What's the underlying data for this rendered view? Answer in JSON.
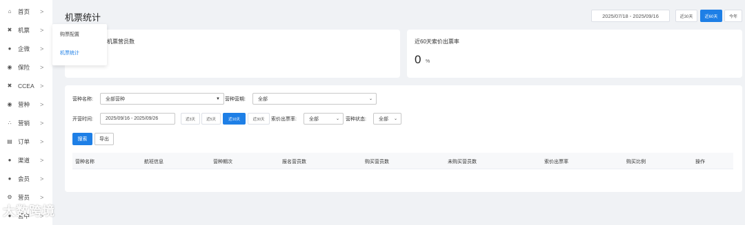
{
  "sidebar": {
    "items": [
      {
        "label": "首页",
        "icon": "home-icon"
      },
      {
        "label": "机票",
        "icon": "tools-icon"
      },
      {
        "label": "企微",
        "icon": "chat-icon"
      },
      {
        "label": "保险",
        "icon": "shield-icon"
      },
      {
        "label": "CCEA",
        "icon": "tools-icon"
      },
      {
        "label": "营种",
        "icon": "badge-icon"
      },
      {
        "label": "营销",
        "icon": "network-icon"
      },
      {
        "label": "订单",
        "icon": "list-icon"
      },
      {
        "label": "渠道",
        "icon": "handshake-icon"
      },
      {
        "label": "会员",
        "icon": "user-icon"
      },
      {
        "label": "营员",
        "icon": "gear-icon"
      },
      {
        "label": "营中",
        "icon": "user-icon"
      }
    ]
  },
  "submenu": {
    "items": [
      {
        "label": "购票配置"
      },
      {
        "label": "机票统计"
      }
    ]
  },
  "header": {
    "title": "机票统计",
    "date_range": "2025/07/18 - 2025/09/16",
    "quick_buttons": [
      {
        "label": "近30天"
      },
      {
        "label": "近60天"
      },
      {
        "label": "今年"
      }
    ]
  },
  "stats": {
    "card1_label": "机票营员数",
    "card2_label": "近60天索价出票率",
    "card2_value": "0",
    "card2_unit": "%"
  },
  "filters": {
    "camp_name_label": "营种名称:",
    "camp_name_value": "全部营种",
    "camp_period_label": "营种营期:",
    "camp_period_value": "全部",
    "open_time_label": "开营时间:",
    "open_time_value": "2025/09/16 - 2025/09/26",
    "quick_ranges": [
      {
        "label": "近3天"
      },
      {
        "label": "近5天"
      },
      {
        "label": "近10天"
      },
      {
        "label": "近30天"
      }
    ],
    "ticket_rate_label": "索价出票率:",
    "ticket_rate_value": "全部",
    "camp_status_label": "营种状态:",
    "camp_status_value": "全部",
    "search_label": "搜索",
    "export_label": "导出"
  },
  "table": {
    "columns": [
      "营种名称",
      "航班信息",
      "营种期次",
      "报名营员数",
      "购买营员数",
      "未购买营员数",
      "索价出票率",
      "购买比例",
      "操作"
    ]
  },
  "watermark": "大数跨境"
}
